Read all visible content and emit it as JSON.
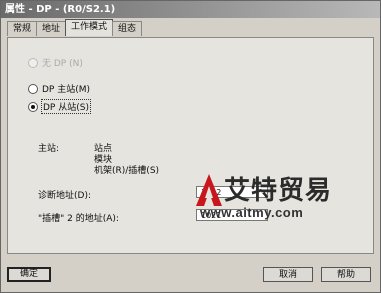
{
  "window": {
    "title": "属性 - DP - (R0/S2.1)"
  },
  "tabs": [
    {
      "label": "常规"
    },
    {
      "label": "地址"
    },
    {
      "label": "工作模式",
      "active": true
    },
    {
      "label": "组态"
    }
  ],
  "mode": {
    "options": [
      {
        "label": "无 DP (N)",
        "selected": false,
        "enabled": false
      },
      {
        "label": "DP 主站(M)",
        "selected": false,
        "enabled": true
      },
      {
        "label": "DP 从站(S)",
        "selected": true,
        "enabled": true
      }
    ]
  },
  "master_info": {
    "label": "主站:",
    "lines": [
      "站点",
      "模块",
      "机架(R)/插槽(S)"
    ]
  },
  "diagnostic_address": {
    "label": "诊断地址(D):",
    "value": "1022"
  },
  "slot2_address": {
    "label": "\"插槽\" 2 的地址(A):",
    "value": "1021"
  },
  "buttons": {
    "ok": "确定",
    "cancel": "取消",
    "help": "帮助"
  },
  "watermark": {
    "brand": "艾特贸易",
    "url": "www.aitmy.com",
    "logo": "red-triangle-logo"
  },
  "colors": {
    "titlebar": "#6a6a6a",
    "panel": "#e6e4de",
    "logo": "#c8161d"
  }
}
